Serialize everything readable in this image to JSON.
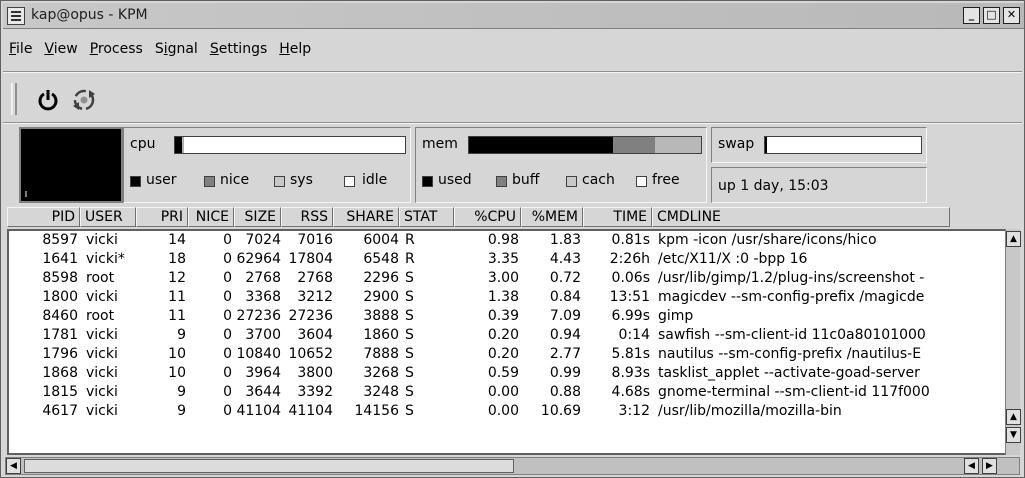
{
  "window": {
    "title": "kap@opus - KPM"
  },
  "menu": [
    {
      "label": "File",
      "u": "F",
      "rest": "ile"
    },
    {
      "label": "View",
      "u": "V",
      "rest": "iew"
    },
    {
      "label": "Process",
      "u": "P",
      "rest": "rocess"
    },
    {
      "label": "Signal",
      "pre": "S",
      "u": "i",
      "rest": "gnal"
    },
    {
      "label": "Settings",
      "u": "S",
      "rest": "ettings"
    },
    {
      "label": "Help",
      "u": "H",
      "rest": "elp"
    }
  ],
  "toolbar": {
    "quit_icon": "power-icon",
    "refresh_icon": "refresh-icon"
  },
  "meters": {
    "cpu_label": "cpu",
    "cpu_legend": [
      "user",
      "nice",
      "sys",
      "idle"
    ],
    "mem_label": "mem",
    "mem_legend": [
      "used",
      "buff",
      "cach",
      "free"
    ],
    "swap_label": "swap",
    "uptime": "up 1 day, 15:03",
    "cpu_fill": {
      "user": 0.03,
      "nice": 0.0,
      "sys": 0.01
    },
    "mem_fill": {
      "used": 0.62,
      "buff": 0.18,
      "cach": 0.2
    },
    "swap_fill": 0.01
  },
  "columns": [
    "PID",
    "USER",
    "PRI",
    "NICE",
    "SIZE",
    "RSS",
    "SHARE",
    "STAT",
    "%CPU",
    "%MEM",
    "TIME",
    "CMDLINE"
  ],
  "rows": [
    [
      "8597",
      "vicki",
      "14",
      "0",
      "7024",
      "7016",
      "6004",
      "R",
      "0.98",
      "1.83",
      "0.81s",
      "kpm -icon /usr/share/icons/hico"
    ],
    [
      "1641",
      "vicki*",
      "18",
      "0",
      "62964",
      "17804",
      "6548",
      "R",
      "3.35",
      "4.43",
      "2:26h",
      "/etc/X11/X :0 -bpp 16"
    ],
    [
      "8598",
      "root",
      "12",
      "0",
      "2768",
      "2768",
      "2296",
      "S",
      "3.00",
      "0.72",
      "0.06s",
      "/usr/lib/gimp/1.2/plug-ins/screenshot -"
    ],
    [
      "1800",
      "vicki",
      "11",
      "0",
      "3368",
      "3212",
      "2900",
      "S",
      "1.38",
      "0.84",
      "13:51",
      "magicdev --sm-config-prefix /magicde"
    ],
    [
      "8460",
      "root",
      "11",
      "0",
      "27236",
      "27236",
      "3888",
      "S",
      "0.39",
      "7.09",
      "6.99s",
      "gimp"
    ],
    [
      "1781",
      "vicki",
      "9",
      "0",
      "3700",
      "3604",
      "1860",
      "S",
      "0.20",
      "0.94",
      "0:14",
      "sawfish --sm-client-id 11c0a80101000"
    ],
    [
      "1796",
      "vicki",
      "10",
      "0",
      "10840",
      "10652",
      "7888",
      "S",
      "0.20",
      "2.77",
      "5.81s",
      "nautilus --sm-config-prefix /nautilus-E"
    ],
    [
      "1868",
      "vicki",
      "10",
      "0",
      "3964",
      "3800",
      "3268",
      "S",
      "0.59",
      "0.99",
      "8.93s",
      "tasklist_applet --activate-goad-server"
    ],
    [
      "1815",
      "vicki",
      "9",
      "0",
      "3644",
      "3392",
      "3248",
      "S",
      "0.00",
      "0.88",
      "4.68s",
      "gnome-terminal --sm-client-id 117f000"
    ],
    [
      "4617",
      "vicki",
      "9",
      "0",
      "41104",
      "41104",
      "14156",
      "S",
      "0.00",
      "10.69",
      "3:12",
      "/usr/lib/mozilla/mozilla-bin"
    ]
  ],
  "colors": {
    "graph_bg": "#000000",
    "used": "#000000",
    "buff": "#808080",
    "cach": "#b8b8b8",
    "free": "#ffffff"
  }
}
